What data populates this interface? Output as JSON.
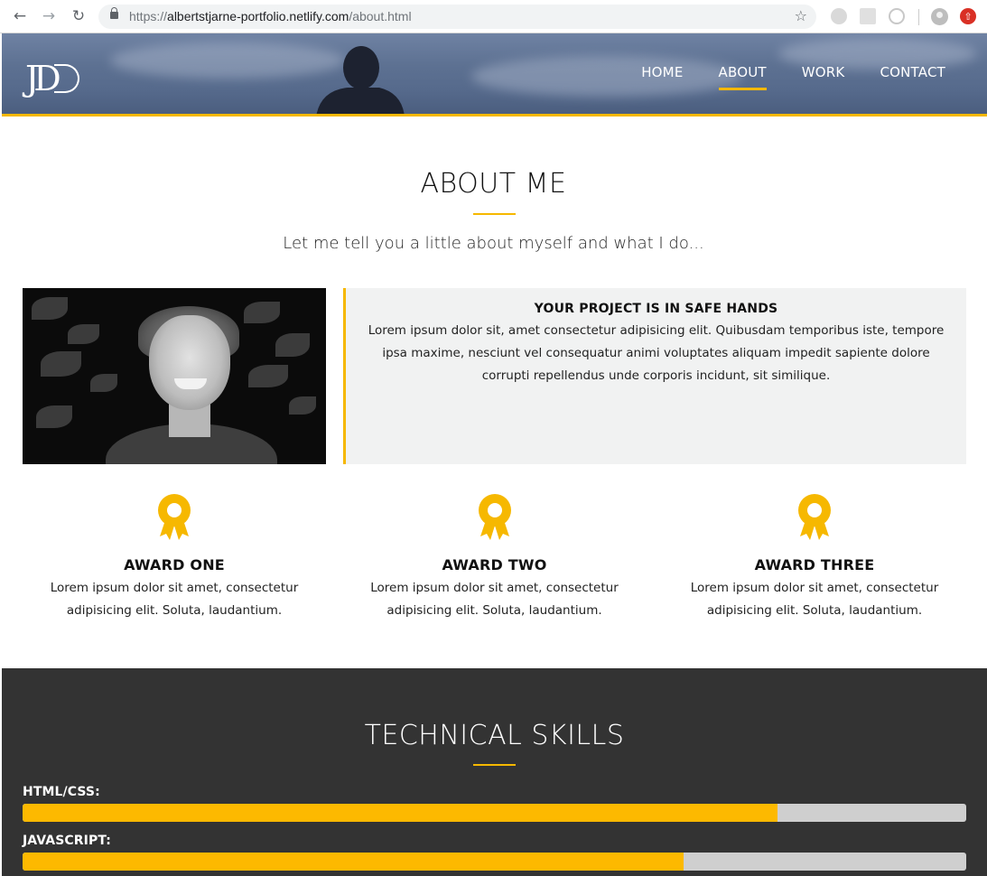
{
  "browser": {
    "url_scheme": "https://",
    "url_host": "albertstjarne-portfolio.netlify.com",
    "url_path": "/about.html"
  },
  "header": {
    "logo": "JD",
    "nav": [
      {
        "label": "HOME",
        "active": false
      },
      {
        "label": "ABOUT",
        "active": true
      },
      {
        "label": "WORK",
        "active": false
      },
      {
        "label": "CONTACT",
        "active": false
      }
    ]
  },
  "about": {
    "title": "ABOUT ME",
    "subtitle": "Let me tell you a little about myself and what I do...",
    "panel_title": "YOUR PROJECT IS IN SAFE HANDS",
    "panel_body": "Lorem ipsum dolor sit, amet consectetur adipisicing elit. Quibusdam temporibus iste, tempore ipsa maxime, nesciunt vel consequatur animi voluptates aliquam impedit sapiente dolore corrupti repellendus unde corporis incidunt, sit similique."
  },
  "awards": [
    {
      "icon": "award-ribbon-icon",
      "title": "AWARD ONE",
      "text": "Lorem ipsum dolor sit amet, consectetur adipisicing elit. Soluta, laudantium."
    },
    {
      "icon": "award-ribbon-icon",
      "title": "AWARD TWO",
      "text": "Lorem ipsum dolor sit amet, consectetur adipisicing elit. Soluta, laudantium."
    },
    {
      "icon": "award-ribbon-icon",
      "title": "AWARD THREE",
      "text": "Lorem ipsum dolor sit amet, consectetur adipisicing elit. Soluta, laudantium."
    }
  ],
  "skills": {
    "title": "TECHNICAL SKILLS",
    "items": [
      {
        "label": "HTML/CSS:",
        "percent": 80
      },
      {
        "label": "JAVASCRIPT:",
        "percent": 70
      }
    ]
  },
  "colors": {
    "accent": "#f6b800",
    "skills_bg": "#333333",
    "bar_track": "#cfcfcf",
    "panel_bg": "#f1f2f2"
  }
}
